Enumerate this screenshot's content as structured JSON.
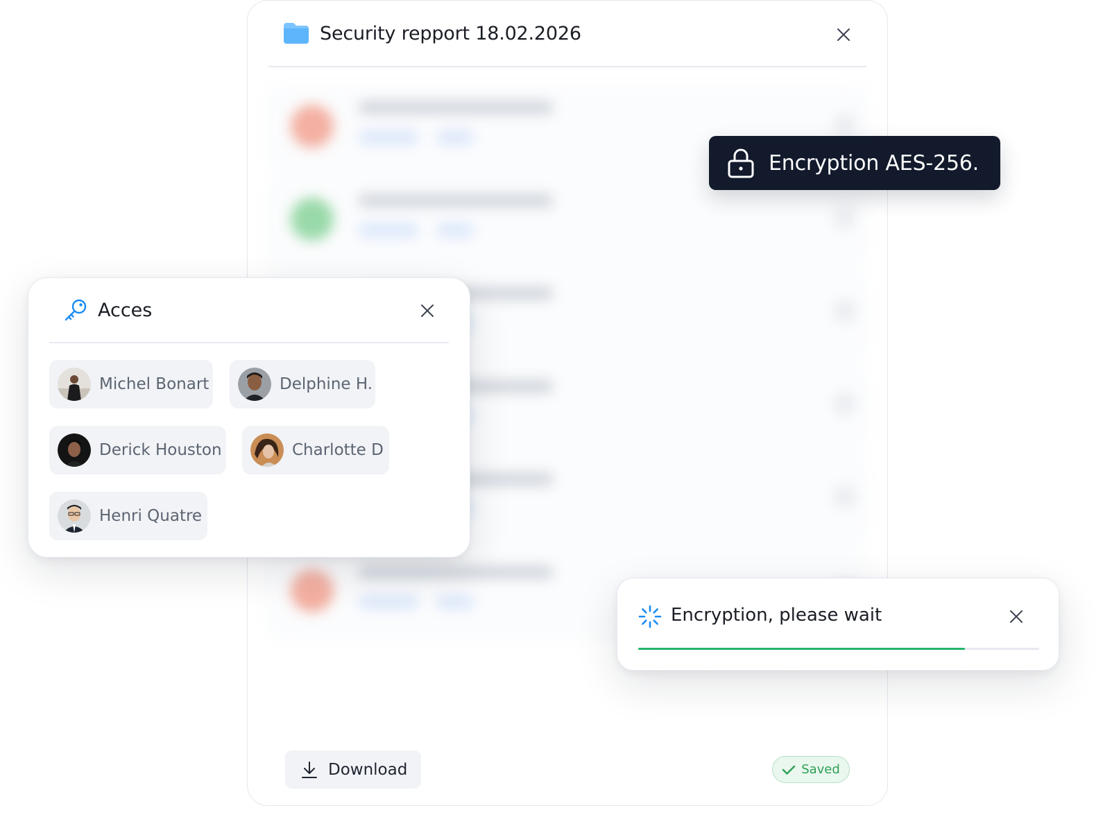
{
  "main_window": {
    "title": "Security repport 18.02.2026",
    "download_label": "Download",
    "saved_label": "Saved"
  },
  "encryption_badge": {
    "label": "Encryption AES-256."
  },
  "access_panel": {
    "title": "Acces",
    "users": [
      {
        "name": "Michel Bonart"
      },
      {
        "name": "Delphine H."
      },
      {
        "name": "Derick Houston"
      },
      {
        "name": "Charlotte D"
      },
      {
        "name": "Henri Quatre"
      }
    ]
  },
  "progress_popup": {
    "title": "Encryption, please wait",
    "progress": 0.815
  },
  "colors": {
    "accent": "#1a8cf5",
    "badge_bg": "#121a2c",
    "progress": "#22b46a",
    "saved": "#2ea056"
  },
  "icons": [
    "folder-icon",
    "close-icon",
    "lock-icon",
    "key-icon",
    "download-icon",
    "check-icon",
    "spinner-icon"
  ]
}
